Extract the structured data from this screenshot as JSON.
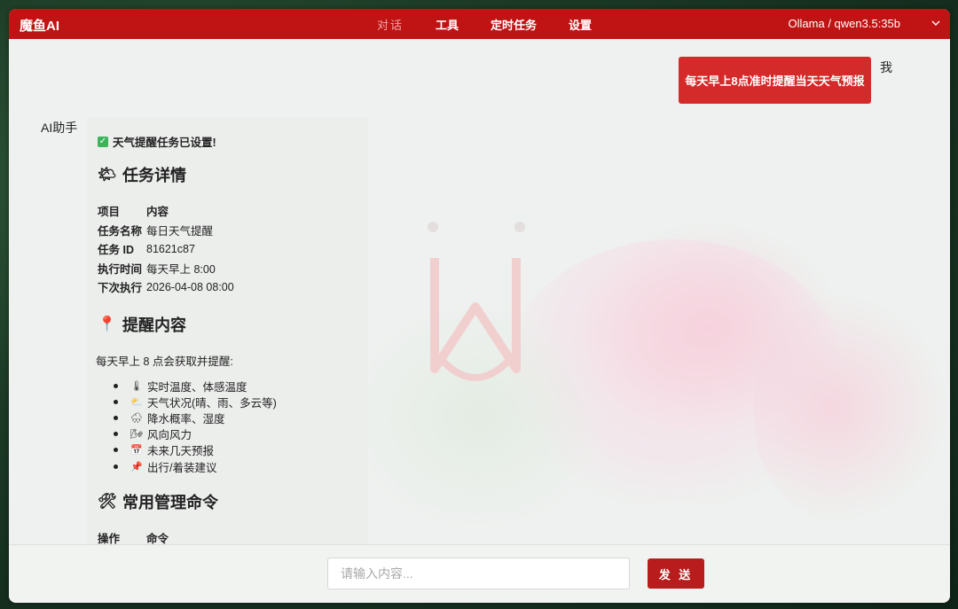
{
  "app": {
    "logo": "魔鱼AI"
  },
  "nav": [
    {
      "label": "对话",
      "active": true
    },
    {
      "label": "工具",
      "active": false
    },
    {
      "label": "定时任务",
      "active": false
    },
    {
      "label": "设置",
      "active": false
    }
  ],
  "model_select": {
    "value": "Ollama / qwen3.5:35b"
  },
  "chat": {
    "user_label": "我",
    "user_message": "每天早上8点准时提醒当天天气预报",
    "ai_label": "AI助手",
    "ai_reply": {
      "status": "天气提醒任务已设置!",
      "section1_title": "任务详情",
      "section1_icon": "sun-cloud-icon",
      "table1": {
        "headers": [
          "项目",
          "内容"
        ],
        "rows": [
          [
            "任务名称",
            "每日天气提醒"
          ],
          [
            "任务 ID",
            "81621c87"
          ],
          [
            "执行时间",
            "每天早上 8:00"
          ],
          [
            "下次执行",
            "2026-04-08 08:00"
          ]
        ]
      },
      "section2_title": "提醒内容",
      "section2_icon": "pin-icon",
      "intro": "每天早上 8 点会获取并提醒:",
      "bullets": [
        {
          "icon": "thermometer-icon",
          "glyph": "🌡",
          "text": "实时温度、体感温度"
        },
        {
          "icon": "weather-icon",
          "glyph": "⛅",
          "text": "天气状况(晴、雨、多云等)"
        },
        {
          "icon": "rain-icon",
          "glyph": "🌧",
          "text": "降水概率、湿度"
        },
        {
          "icon": "wind-icon",
          "glyph": "🌬",
          "text": "风向风力"
        },
        {
          "icon": "calendar-icon",
          "glyph": "📅",
          "text": "未来几天预报"
        },
        {
          "icon": "pushpin-icon",
          "glyph": "📌",
          "text": "出行/着装建议"
        }
      ],
      "section3_title": "常用管理命令",
      "section3_icon": "tools-icon",
      "table2": {
        "headers": [
          "操作",
          "命令"
        ]
      }
    }
  },
  "composer": {
    "placeholder": "请输入内容...",
    "send_label": "发 送"
  },
  "colors": {
    "topbar": "#c01414",
    "user_bubble": "#d42a2a",
    "send_button": "#b81c1c"
  }
}
